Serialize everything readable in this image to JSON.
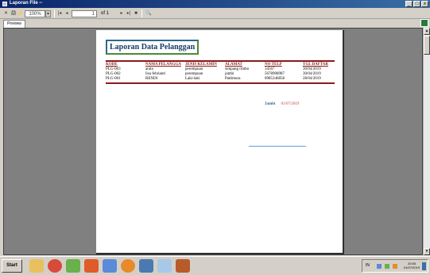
{
  "window": {
    "title": "Laporan File --",
    "buttons": [
      "_",
      "□",
      "x"
    ]
  },
  "toolbar": {
    "zoom": "100%",
    "page_current": "1",
    "page_of": "of 1"
  },
  "tabs": [
    {
      "label": "Preview"
    }
  ],
  "report": {
    "title": "Laporan Data Pelanggan",
    "columns": [
      "KODE",
      "NAMA PELANGGA",
      "JENIS KELAMIN",
      "ALAMAT",
      "NO TELP",
      "TGL DAFTAR"
    ],
    "rows": [
      [
        "PLG-003",
        "anita",
        "perempuan",
        "simpang rimbo",
        "34567",
        "30/04/2019"
      ],
      [
        "PLG-002",
        "lisa febrianti",
        "perempuan",
        "jambi",
        "5678908987",
        "30/04/2019"
      ],
      [
        "PLG-001",
        "RENDI",
        "Laki-laki",
        "Pattimura",
        "0985346858",
        "28/04/2019"
      ]
    ],
    "place": "Jambi",
    "date": "01/07/2019"
  },
  "taskbar": {
    "start_label": "Start",
    "lang": "IN",
    "time": "20:55",
    "date": "01/07/2019",
    "apps": [
      "folder-icon",
      "chrome-icon",
      "notepad-icon",
      "media-icon",
      "calc-icon",
      "firefox-icon",
      "tool-icon",
      "paint-icon",
      "game-icon"
    ]
  }
}
